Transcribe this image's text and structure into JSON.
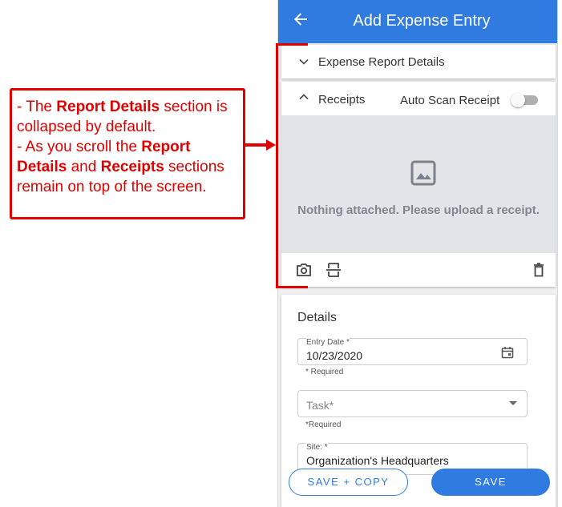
{
  "annotation": {
    "line1_a": "- The ",
    "line1_b": "Report Details",
    "line1_c": " section is collapsed by default.",
    "line2_a": "- As you scroll the ",
    "line2_b": "Report Details",
    "line2_c": " and ",
    "line2_d": "Receipts",
    "line2_e": " sections remain on top of the screen.",
    "color": "#e00000"
  },
  "appbar": {
    "title": "Add Expense Entry",
    "back_icon": "arrow-left-icon",
    "color": "#2f7be0"
  },
  "report_section": {
    "label": "Expense Report Details",
    "expanded": false
  },
  "receipts_section": {
    "label": "Receipts",
    "auto_scan_label": "Auto Scan Receipt",
    "auto_scan_on": false,
    "empty_message": "Nothing attached. Please upload a receipt.",
    "icons": [
      "camera-icon",
      "scan-icon",
      "trash-icon"
    ]
  },
  "details": {
    "title": "Details",
    "entry_date": {
      "label": "Entry Date *",
      "value": "10/23/2020",
      "helper": "* Required"
    },
    "task": {
      "placeholder": "Task*",
      "helper": "*Required"
    },
    "site": {
      "label": "Site: *",
      "value": "Organization's Headquarters"
    }
  },
  "actions": {
    "save_copy": "SAVE + COPY",
    "save": "SAVE"
  }
}
